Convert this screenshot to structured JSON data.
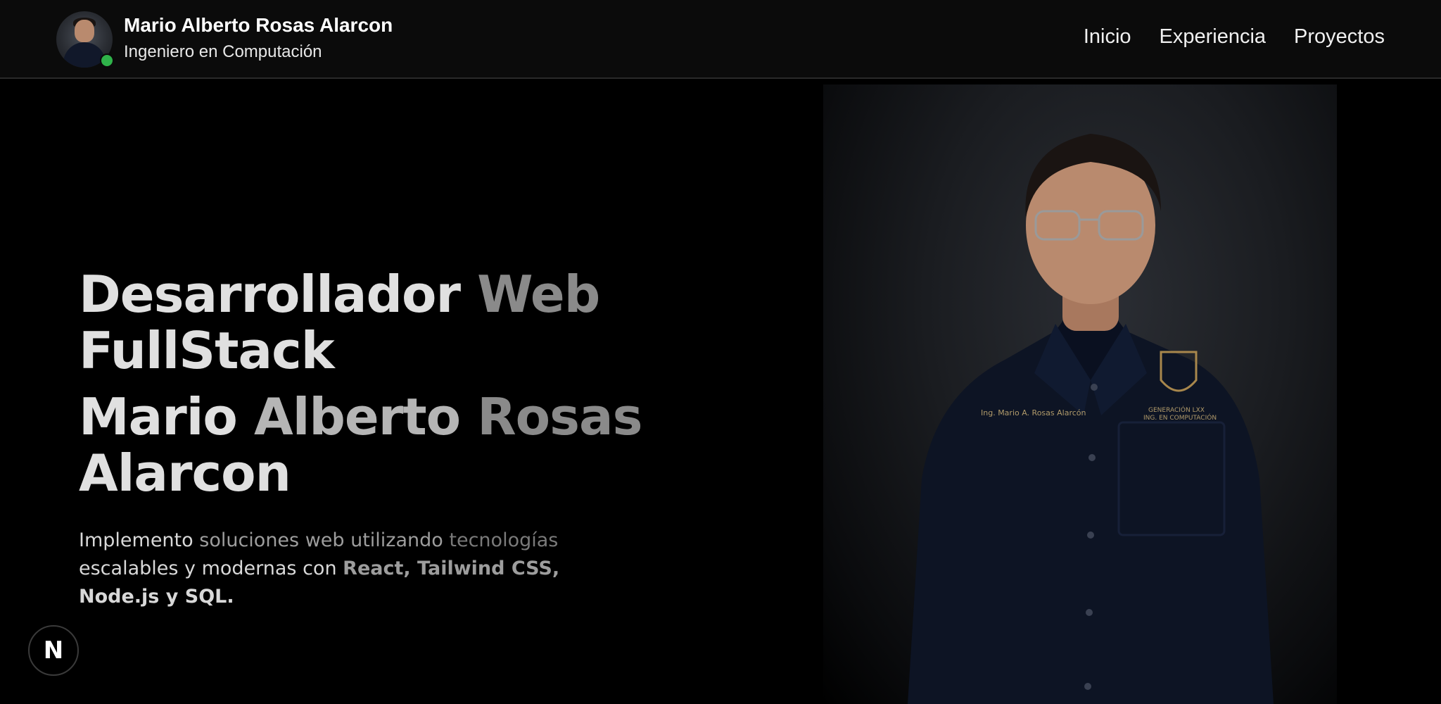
{
  "header": {
    "name": "Mario Alberto Rosas Alarcon",
    "role": "Ingeniero en Computación",
    "status_color": "#2fb34a"
  },
  "nav": {
    "items": [
      "Inicio",
      "Experiencia",
      "Proyectos"
    ]
  },
  "hero": {
    "title_parts": [
      "Desarrollador",
      "Web",
      "FullStack"
    ],
    "name_parts": [
      "Mario",
      "Alberto",
      "Rosas",
      "Alarcon"
    ],
    "description": {
      "p1": "Implemento",
      "p2": "soluciones web utilizando",
      "p3": "tecnologías",
      "p4": "escalables y modernas con",
      "p5": "React, Tailwind CSS,",
      "p6": "Node.js y SQL."
    },
    "photo_icon": "portrait-photo",
    "photo_shirt_text_left": "Ing. Mario A. Rosas Alarcón",
    "photo_shirt_text_right_1": "GENERACIÓN LXX",
    "photo_shirt_text_right_2": "ING. EN COMPUTACIÓN"
  },
  "badge": {
    "label": "N",
    "icon": "nextjs-icon"
  }
}
